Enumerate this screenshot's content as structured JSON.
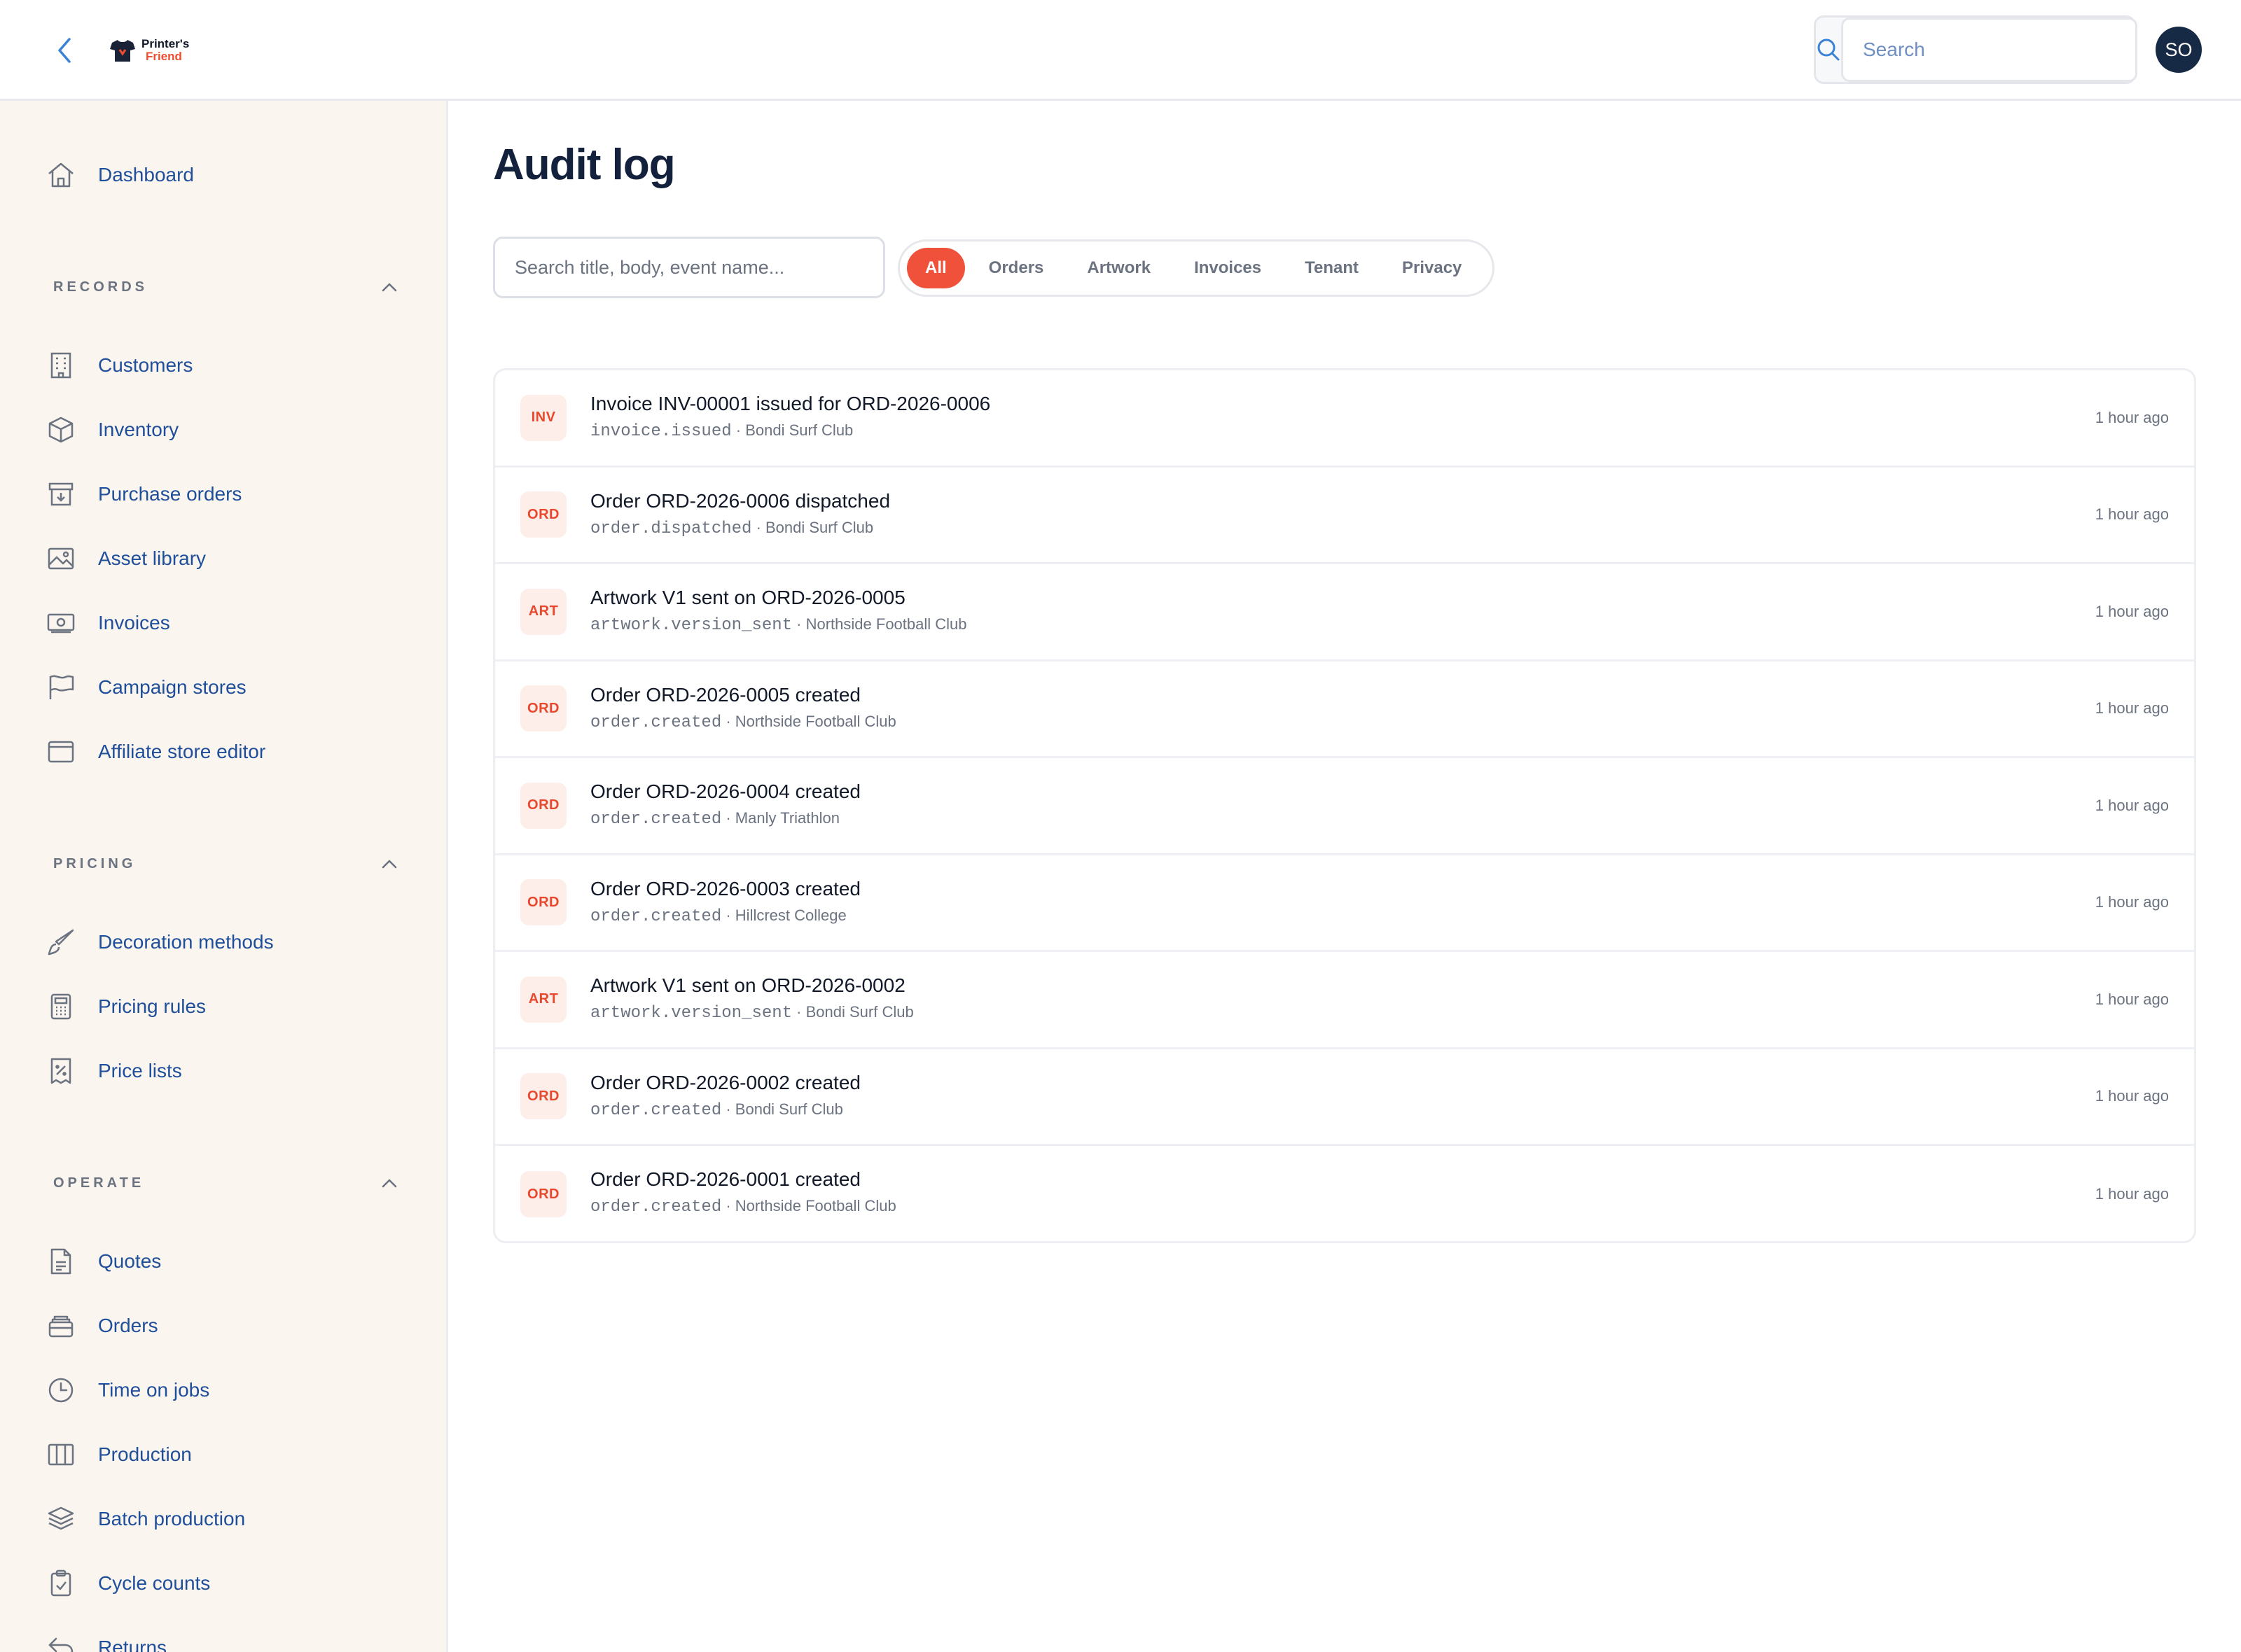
{
  "header": {
    "logo_line1": "Printer's",
    "logo_line2": "Friend",
    "search_placeholder": "Search",
    "avatar_initials": "SO"
  },
  "sidebar": {
    "dashboard": "Dashboard",
    "sections": {
      "records": {
        "title": "RECORDS",
        "items": [
          "Customers",
          "Inventory",
          "Purchase orders",
          "Asset library",
          "Invoices",
          "Campaign stores",
          "Affiliate store editor"
        ]
      },
      "pricing": {
        "title": "PRICING",
        "items": [
          "Decoration methods",
          "Pricing rules",
          "Price lists"
        ]
      },
      "operate": {
        "title": "OPERATE",
        "items": [
          "Quotes",
          "Orders",
          "Time on jobs",
          "Production",
          "Batch production",
          "Cycle counts",
          "Returns"
        ]
      }
    }
  },
  "main": {
    "title": "Audit log",
    "filter_placeholder": "Search title, body, event name...",
    "tabs": [
      "All",
      "Orders",
      "Artwork",
      "Invoices",
      "Tenant",
      "Privacy"
    ],
    "active_tab": "All",
    "entries": [
      {
        "badge": "INV",
        "title": "Invoice INV-00001 issued for ORD-2026-0006",
        "event": "invoice.issued",
        "client": "· Bondi Surf Club",
        "time": "1 hour ago"
      },
      {
        "badge": "ORD",
        "title": "Order ORD-2026-0006 dispatched",
        "event": "order.dispatched",
        "client": "· Bondi Surf Club",
        "time": "1 hour ago"
      },
      {
        "badge": "ART",
        "title": "Artwork V1 sent on ORD-2026-0005",
        "event": "artwork.version_sent",
        "client": "· Northside Football Club",
        "time": "1 hour ago"
      },
      {
        "badge": "ORD",
        "title": "Order ORD-2026-0005 created",
        "event": "order.created",
        "client": "· Northside Football Club",
        "time": "1 hour ago"
      },
      {
        "badge": "ORD",
        "title": "Order ORD-2026-0004 created",
        "event": "order.created",
        "client": "· Manly Triathlon",
        "time": "1 hour ago"
      },
      {
        "badge": "ORD",
        "title": "Order ORD-2026-0003 created",
        "event": "order.created",
        "client": "· Hillcrest College",
        "time": "1 hour ago"
      },
      {
        "badge": "ART",
        "title": "Artwork V1 sent on ORD-2026-0002",
        "event": "artwork.version_sent",
        "client": "· Bondi Surf Club",
        "time": "1 hour ago"
      },
      {
        "badge": "ORD",
        "title": "Order ORD-2026-0002 created",
        "event": "order.created",
        "client": "· Bondi Surf Club",
        "time": "1 hour ago"
      },
      {
        "badge": "ORD",
        "title": "Order ORD-2026-0001 created",
        "event": "order.created",
        "client": "· Northside Football Club",
        "time": "1 hour ago"
      }
    ]
  },
  "colors": {
    "accent": "#f0513a",
    "navy": "#172a45",
    "sidebar_bg": "#faf5ef",
    "link_blue": "#1f4f9a"
  }
}
